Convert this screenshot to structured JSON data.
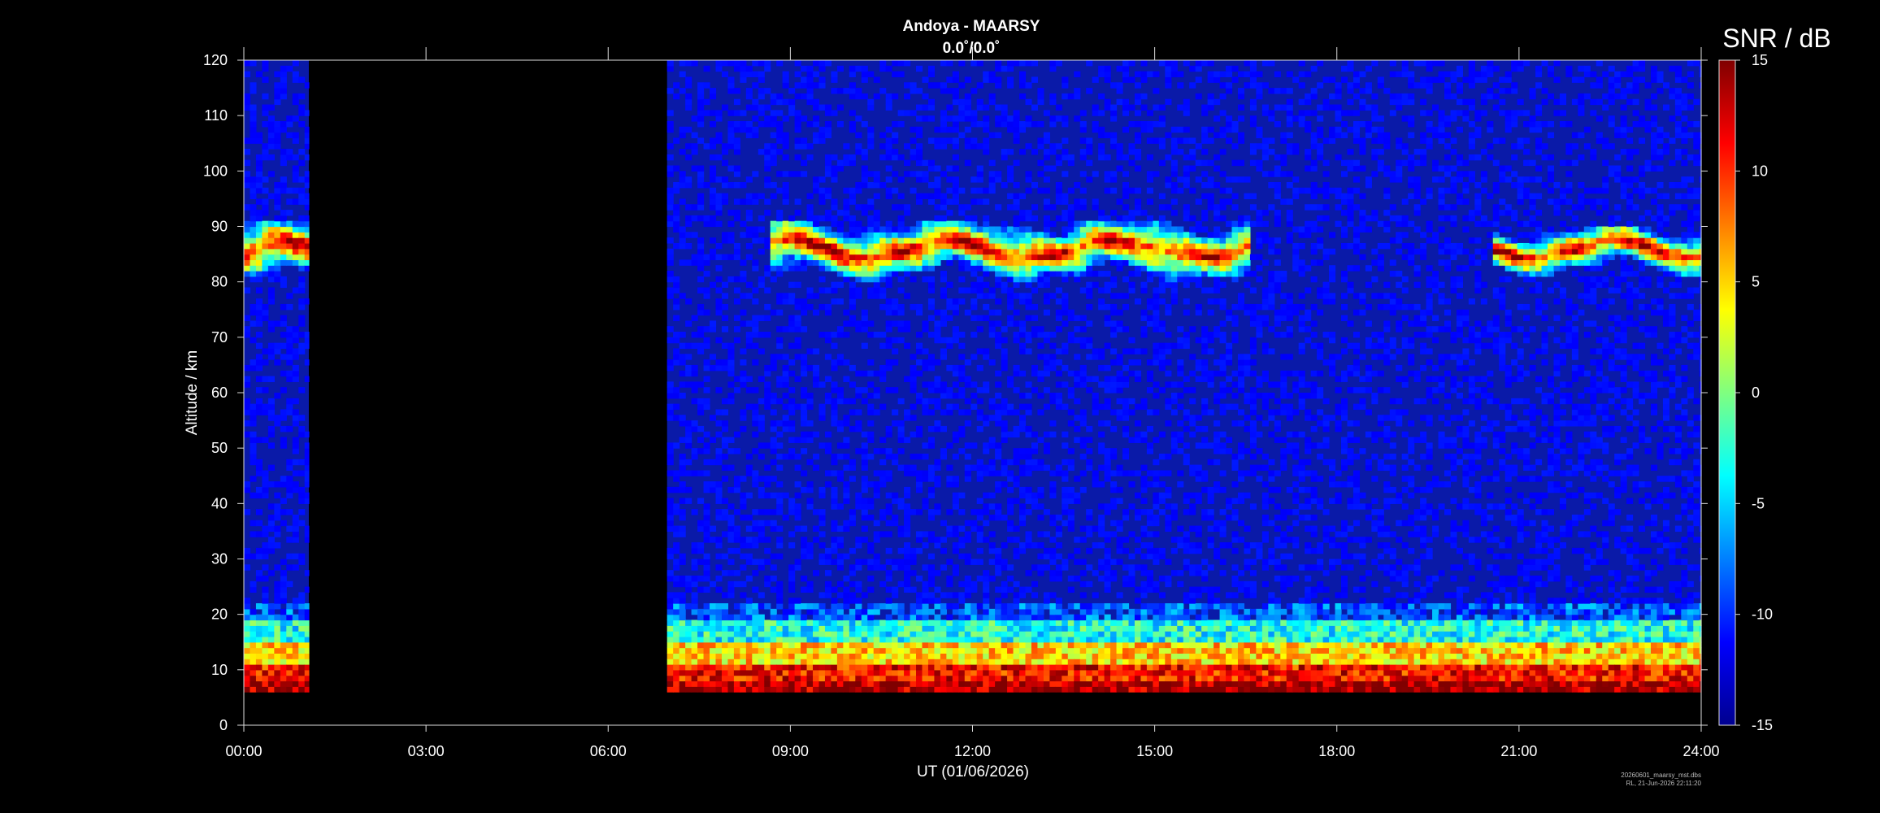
{
  "chart_data": {
    "type": "heatmap",
    "title": "Andoya - MAARSY",
    "subtitle": "0.0˚/0.0˚",
    "xlabel": "UT (01/06/2026)",
    "ylabel": "Altitude / km",
    "xlim": [
      0,
      24
    ],
    "ylim": [
      0,
      120
    ],
    "x_ticks": [
      0,
      3,
      6,
      9,
      12,
      15,
      18,
      21,
      24
    ],
    "x_tick_labels": [
      "00:00",
      "03:00",
      "06:00",
      "09:00",
      "12:00",
      "15:00",
      "18:00",
      "21:00",
      "24:00"
    ],
    "y_ticks": [
      0,
      10,
      20,
      30,
      40,
      50,
      60,
      70,
      80,
      90,
      100,
      110,
      120
    ],
    "y_tick_labels": [
      "0",
      "10",
      "20",
      "30",
      "40",
      "50",
      "60",
      "70",
      "80",
      "90",
      "100",
      "110",
      "120"
    ],
    "colorbar": {
      "title": "SNR / dB",
      "range": [
        -15,
        15
      ],
      "ticks": [
        -15,
        -10,
        -5,
        0,
        5,
        10,
        15
      ],
      "tick_labels": [
        "-15",
        "-10",
        "-5",
        "0",
        "5",
        "10",
        "15"
      ],
      "colormap": "jet"
    },
    "data_coverage_hours": [
      [
        0.0,
        1.07
      ],
      [
        6.97,
        24.0
      ]
    ],
    "altitude_coverage_km": [
      6,
      120
    ],
    "features": [
      {
        "type": "PMSE layer",
        "altitude_km": [
          80,
          90
        ],
        "hours": [
          0.0,
          1.07
        ],
        "snr_db": 15
      },
      {
        "type": "PMSE layer",
        "altitude_km": [
          81,
          90
        ],
        "hours": [
          8.6,
          16.5
        ],
        "snr_db": 15
      },
      {
        "type": "PMSE layer",
        "altitude_km": [
          82,
          89
        ],
        "hours": [
          20.5,
          24.0
        ],
        "snr_db": 15
      },
      {
        "type": "lower atmosphere echo",
        "altitude_km": [
          6,
          22
        ],
        "hours": [
          0.0,
          24.0
        ],
        "snr_db": 12
      }
    ],
    "grid": false,
    "legend": "colorbar-right"
  },
  "footer": {
    "line1": "20260601_maarsy_mst.dbs",
    "line2": "RL, 21-Jun-2026 22:11:20"
  }
}
